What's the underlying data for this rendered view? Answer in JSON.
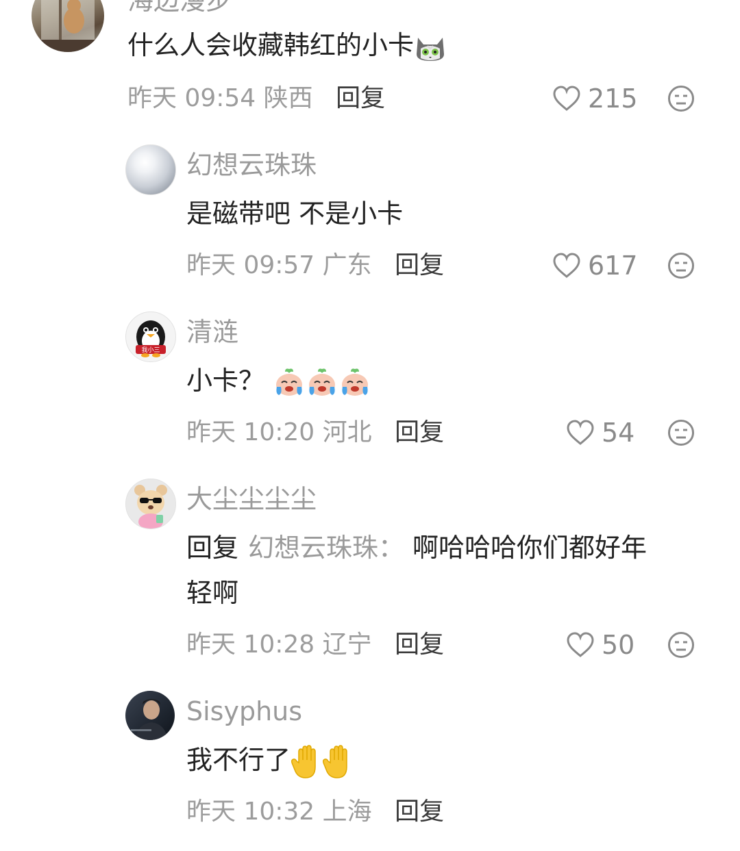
{
  "comments": [
    {
      "username": "海边漫步",
      "text": "什么人会收藏韩红的小卡",
      "time": "昨天 09:54",
      "location": "陕西",
      "reply_label": "回复",
      "likes": "215",
      "emoji": [
        "cat-face-emoji"
      ]
    },
    {
      "username": "幻想云珠珠",
      "text": "是磁带吧 不是小卡",
      "time": "昨天 09:57",
      "location": "广东",
      "reply_label": "回复",
      "likes": "617"
    },
    {
      "username": "清涟",
      "text": "小卡？",
      "time": "昨天 10:20",
      "location": "河北",
      "reply_label": "回复",
      "likes": "54",
      "emoji": [
        "crying-peach-emoji",
        "crying-peach-emoji",
        "crying-peach-emoji"
      ],
      "avatar_badge": "我小三"
    },
    {
      "username": "大尘尘尘尘",
      "reply_prefix": "回复",
      "reply_to": "幻想云珠珠：",
      "text_line1": "啊哈哈哈你们都好年",
      "text_line2": "轻啊",
      "time": "昨天 10:28",
      "location": "辽宁",
      "reply_label": "回复",
      "likes": "50"
    },
    {
      "username": "Sisyphus",
      "text": "我不行了",
      "time": "昨天 10:32",
      "location": "上海",
      "reply_label": "回复",
      "emoji": [
        "raised-hand-emoji",
        "raised-hand-emoji"
      ]
    }
  ],
  "colors": {
    "username": "#9a9a9a",
    "text": "#222222",
    "meta": "#9c9c9c",
    "icon": "#8a8a8a"
  }
}
